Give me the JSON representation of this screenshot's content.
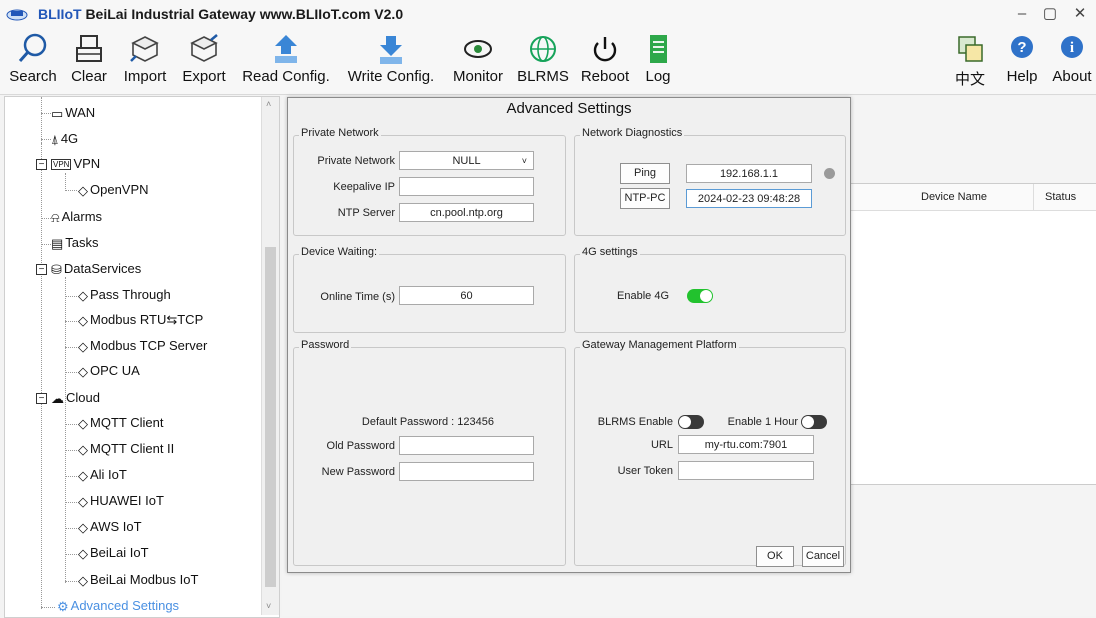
{
  "window": {
    "brand": "BLIIoT",
    "title": "BeiLai Industrial Gateway www.BLIIoT.com V2.0"
  },
  "toolbar": {
    "items": [
      {
        "label": "Search",
        "icon": "search-icon"
      },
      {
        "label": "Clear",
        "icon": "clear-icon"
      },
      {
        "label": "Import",
        "icon": "import-icon"
      },
      {
        "label": "Export",
        "icon": "export-icon"
      },
      {
        "label": "Read Config.",
        "icon": "read-config-icon"
      },
      {
        "label": "Write Config.",
        "icon": "write-config-icon"
      },
      {
        "label": "Monitor",
        "icon": "monitor-icon"
      },
      {
        "label": "BLRMS",
        "icon": "globe-icon"
      },
      {
        "label": "Reboot",
        "icon": "power-icon"
      },
      {
        "label": "Log",
        "icon": "log-icon"
      }
    ],
    "right": [
      {
        "label": "中文",
        "icon": "language-icon"
      },
      {
        "label": "Help",
        "icon": "help-icon"
      },
      {
        "label": "About",
        "icon": "info-icon"
      }
    ]
  },
  "tree": {
    "wan": "WAN",
    "g4": "4G",
    "vpn": "VPN",
    "openvpn": "OpenVPN",
    "alarms": "Alarms",
    "tasks": "Tasks",
    "dataservices": "DataServices",
    "pass_through": "Pass Through",
    "modbus_rtu_tcp": "Modbus RTU⇆TCP",
    "modbus_tcp_server": "Modbus TCP Server",
    "opc_ua": "OPC UA",
    "cloud": "Cloud",
    "mqtt_client": "MQTT Client",
    "mqtt_client_2": "MQTT Client II",
    "ali_iot": "Ali IoT",
    "huawei_iot": "HUAWEI IoT",
    "aws_iot": "AWS IoT",
    "beilai_iot": "BeiLai IoT",
    "beilai_modbus_iot": "BeiLai Modbus IoT",
    "advanced_settings": "Advanced Settings"
  },
  "device_table": {
    "col_name": "Device Name",
    "col_status": "Status"
  },
  "dialog": {
    "title": "Advanced Settings",
    "private_network": {
      "group": "Private Network",
      "label_private": "Private Network",
      "private_value": "NULL",
      "label_keepalive": "Keepalive IP",
      "keepalive_value": "",
      "label_ntp": "NTP Server",
      "ntp_value": "cn.pool.ntp.org"
    },
    "diagnostics": {
      "group": "Network Diagnostics",
      "ping_button": "Ping",
      "ping_target": "192.168.1.1",
      "ntp_pc_button": "NTP-PC",
      "ntp_pc_value": "2024-02-23 09:48:28",
      "status_color": "#9a9a9a"
    },
    "device_waiting": {
      "group": "Device Waiting:",
      "label_online": "Online Time (s)",
      "online_value": "60"
    },
    "g4": {
      "group": "4G settings",
      "label_enable": "Enable 4G",
      "enabled": true
    },
    "password": {
      "group": "Password",
      "default_text": "Default Password : 123456",
      "label_old": "Old Password",
      "old_value": "",
      "label_new": "New Password",
      "new_value": ""
    },
    "gmp": {
      "group": "Gateway Management Platform",
      "label_blrms": "BLRMS Enable",
      "blrms_enabled": false,
      "label_hour": "Enable 1 Hour",
      "hour_enabled": false,
      "label_url": "URL",
      "url_value": "my-rtu.com:7901",
      "label_token": "User Token",
      "token_value": ""
    },
    "ok": "OK",
    "cancel": "Cancel"
  },
  "colors": {
    "toggle_on": "#22c22e",
    "toggle_off": "#3a3a3a",
    "brand_blue": "#2257b8",
    "advanced_link": "#4a90e2"
  }
}
